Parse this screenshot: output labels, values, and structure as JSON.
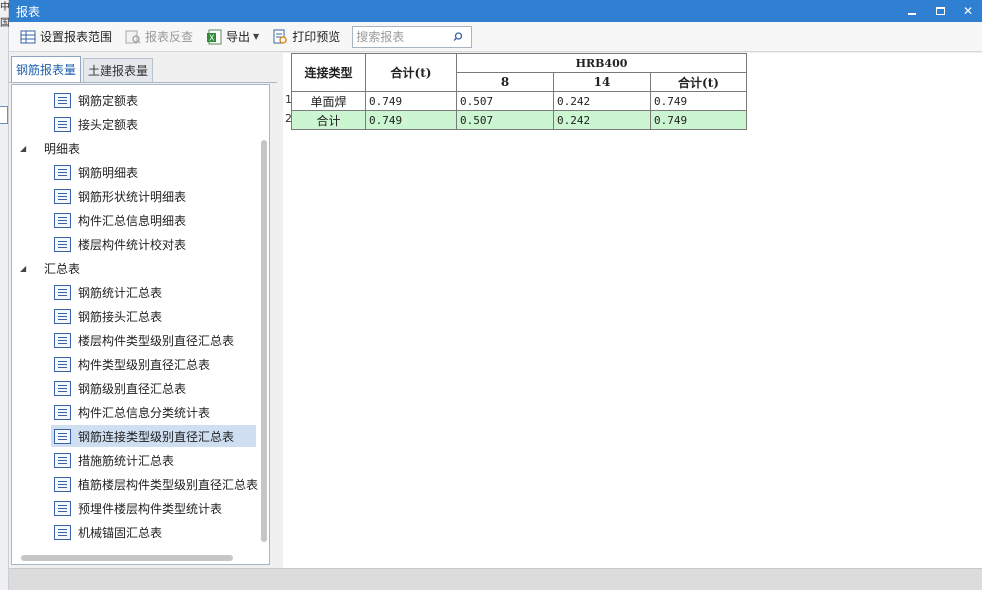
{
  "window": {
    "title": "报表"
  },
  "edge_strip": {
    "chars": [
      "中",
      "国"
    ]
  },
  "toolbar": {
    "set_range": "设置报表范围",
    "reverse_check": "报表反查",
    "export": "导出",
    "print_preview": "打印预览",
    "search_placeholder": "搜索报表"
  },
  "tabs": [
    "钢筋报表量",
    "土建报表量"
  ],
  "tree": [
    {
      "kind": "leaf",
      "label": "钢筋定额表"
    },
    {
      "kind": "leaf",
      "label": "接头定额表"
    },
    {
      "kind": "group",
      "label": "明细表"
    },
    {
      "kind": "leaf",
      "label": "钢筋明细表"
    },
    {
      "kind": "leaf",
      "label": "钢筋形状统计明细表"
    },
    {
      "kind": "leaf",
      "label": "构件汇总信息明细表"
    },
    {
      "kind": "leaf",
      "label": "楼层构件统计校对表"
    },
    {
      "kind": "group",
      "label": "汇总表"
    },
    {
      "kind": "leaf",
      "label": "钢筋统计汇总表"
    },
    {
      "kind": "leaf",
      "label": "钢筋接头汇总表"
    },
    {
      "kind": "leaf",
      "label": "楼层构件类型级别直径汇总表"
    },
    {
      "kind": "leaf",
      "label": "构件类型级别直径汇总表"
    },
    {
      "kind": "leaf",
      "label": "钢筋级别直径汇总表"
    },
    {
      "kind": "leaf",
      "label": "构件汇总信息分类统计表"
    },
    {
      "kind": "leaf",
      "label": "钢筋连接类型级别直径汇总表",
      "selected": true
    },
    {
      "kind": "leaf",
      "label": "措施筋统计汇总表"
    },
    {
      "kind": "leaf",
      "label": "植筋楼层构件类型级别直径汇总表"
    },
    {
      "kind": "leaf",
      "label": "预埋件楼层构件类型统计表"
    },
    {
      "kind": "leaf",
      "label": "机械锚固汇总表"
    }
  ],
  "report": {
    "headers": {
      "conn_type": "连接类型",
      "total": "合计(t)",
      "grade": "HRB400",
      "sub": [
        "8",
        "14",
        "合计(t)"
      ]
    },
    "rows": [
      {
        "num": "1",
        "label": "单面焊",
        "values": [
          "0.749",
          "0.507",
          "0.242",
          "0.749"
        ]
      },
      {
        "num": "2",
        "label": "合计",
        "values": [
          "0.749",
          "0.507",
          "0.242",
          "0.749"
        ],
        "total": true
      }
    ]
  }
}
